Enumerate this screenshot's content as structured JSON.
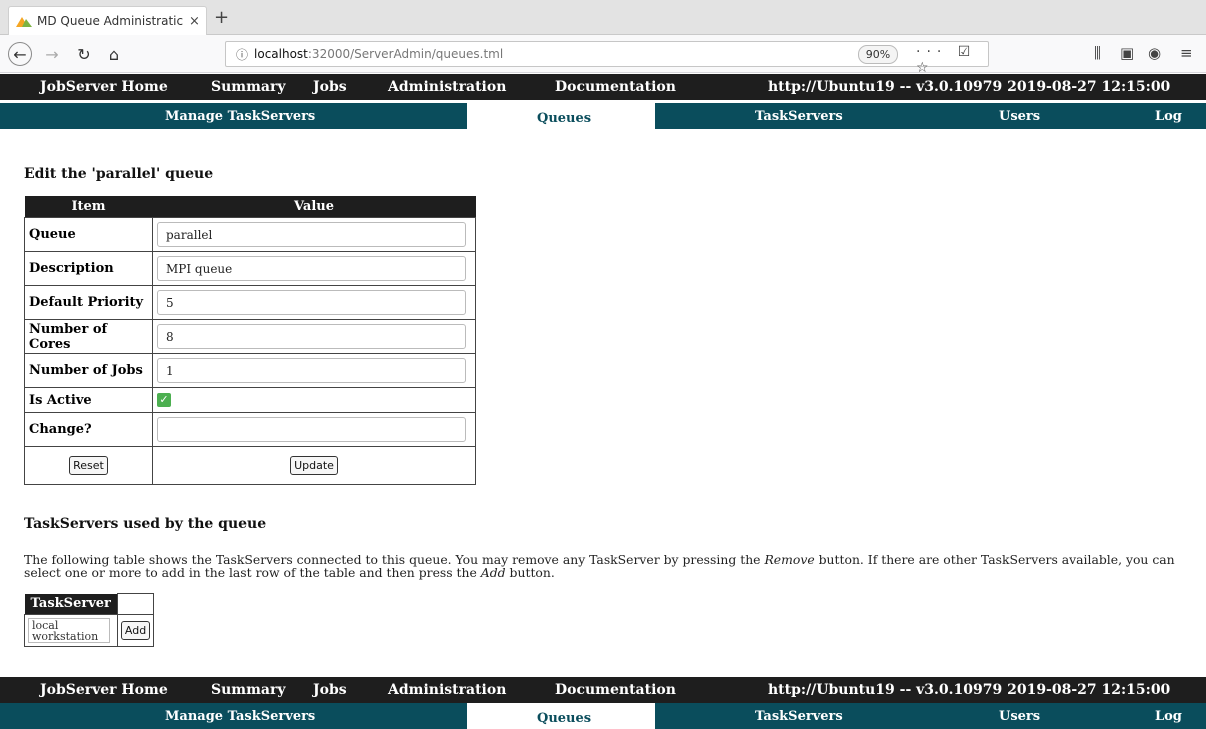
{
  "browser": {
    "tab_title": "MD Queue Administratic",
    "tab_close": "×",
    "new_tab": "+",
    "url_host": "localhost",
    "url_path": ":32000/ServerAdmin/queues.tml",
    "zoom": "90%",
    "url_actions": "··· ☑ ☆"
  },
  "top_nav": {
    "home": "JobServer Home",
    "summary": "Summary",
    "jobs": "Jobs",
    "administration": "Administration",
    "documentation": "Documentation",
    "server_info": "http://Ubuntu19 -- v3.0.10979  2019-08-27 12:15:00"
  },
  "sub_nav": {
    "manage": "Manage TaskServers",
    "queues": "Queues",
    "taskservers": "TaskServers",
    "users": "Users",
    "log": "Log"
  },
  "edit": {
    "heading": "Edit the 'parallel' queue",
    "col_item": "Item",
    "col_value": "Value",
    "rows": [
      {
        "label": "Queue",
        "value": "parallel"
      },
      {
        "label": "Description",
        "value": "MPI queue"
      },
      {
        "label": "Default Priority",
        "value": "5"
      },
      {
        "label": "Number of Cores",
        "value": "8"
      },
      {
        "label": "Number of Jobs",
        "value": "1"
      }
    ],
    "is_active_label": "Is Active",
    "is_active": true,
    "change_label": "Change?",
    "change_value": "",
    "reset_label": "Reset",
    "update_label": "Update"
  },
  "taskservers_section": {
    "heading": "TaskServers used by the queue",
    "para_1": "The following table shows the TaskServers connected to this queue. You may remove any TaskServer by pressing the ",
    "remove_word": "Remove",
    "para_2": " button. If there are other TaskServers available, you can select one or more to add in the last row of the table and then press the ",
    "add_word": "Add",
    "para_3": " button.",
    "col_taskserver": "TaskServer",
    "option": "local workstation",
    "add_label": "Add"
  }
}
